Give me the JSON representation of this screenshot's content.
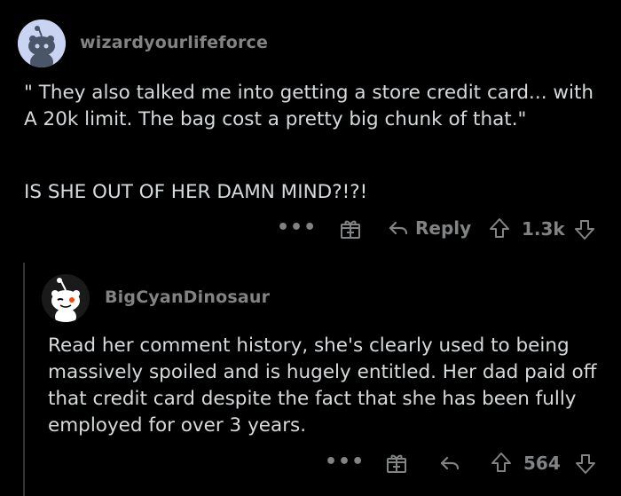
{
  "comment1": {
    "username": "wizardyourlifeforce",
    "body_line1": "\" They also talked me into getting a store credit card... with A 20k limit. The bag cost a pretty big chunk of that.\"",
    "body_line2": "IS SHE OUT OF HER DAMN MIND?!?!",
    "more_label": "•••",
    "reply_label": "Reply",
    "vote_count": "1.3k"
  },
  "comment2": {
    "username": "BigCyanDinosaur",
    "body": "Read her comment history, she's clearly used to being massively spoiled and is hugely entitled. Her dad paid off that credit card despite the fact that she has been fully employed for over 3 years.",
    "more_label": "•••",
    "vote_count": "564"
  },
  "colors": {
    "background": "#000000",
    "text": "#d7dadc",
    "muted": "#818384"
  },
  "icons": [
    "snoo-avatar-icon",
    "award-gift-icon",
    "reply-arrow-icon",
    "upvote-icon",
    "downvote-icon",
    "more-options-icon"
  ]
}
